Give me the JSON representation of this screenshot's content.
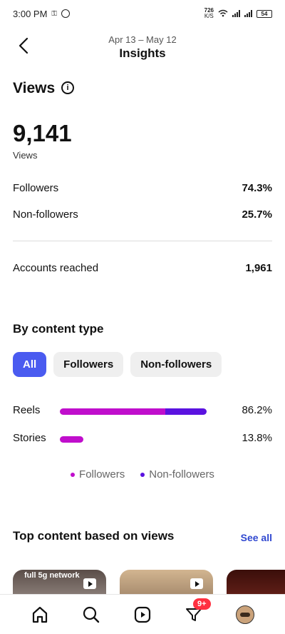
{
  "status_bar": {
    "time": "3:00 PM",
    "speed": "726",
    "speed_unit": "K/S",
    "battery": "54"
  },
  "header": {
    "date_range": "Apr 13 – May 12",
    "title": "Insights"
  },
  "views": {
    "title": "Views",
    "total": "9,141",
    "total_label": "Views",
    "rows": [
      {
        "label": "Followers",
        "value": "74.3%"
      },
      {
        "label": "Non-followers",
        "value": "25.7%"
      }
    ]
  },
  "reach": {
    "label": "Accounts reached",
    "value": "1,961"
  },
  "content_type": {
    "title": "By content type",
    "filters": [
      "All",
      "Followers",
      "Non-followers"
    ],
    "active_filter": "All",
    "items": [
      {
        "label": "Reels",
        "value": "86.2%",
        "followers_fraction": 0.72,
        "nonfollowers_fraction": 0.28,
        "scale": 1.0
      },
      {
        "label": "Stories",
        "value": "13.8%",
        "followers_fraction": 1.0,
        "nonfollowers_fraction": 0.0,
        "scale": 0.16
      }
    ],
    "legend": [
      "Followers",
      "Non-followers"
    ],
    "colors": {
      "followers": "#c00ecc",
      "nonfollowers": "#5a12e0"
    }
  },
  "top_content": {
    "title": "Top content based on views",
    "see_all": "See all",
    "thumb_caption": "full 5g network",
    "colors": [
      "#7a6b63",
      "#b49a7a",
      "#5c1a14"
    ]
  },
  "bottom_nav": {
    "badge": "9+",
    "icons": [
      "home-icon",
      "search-icon",
      "reels-icon",
      "activity-icon",
      "profile-avatar"
    ]
  },
  "accent": "#4a5bf0",
  "link_color": "#3048d0"
}
